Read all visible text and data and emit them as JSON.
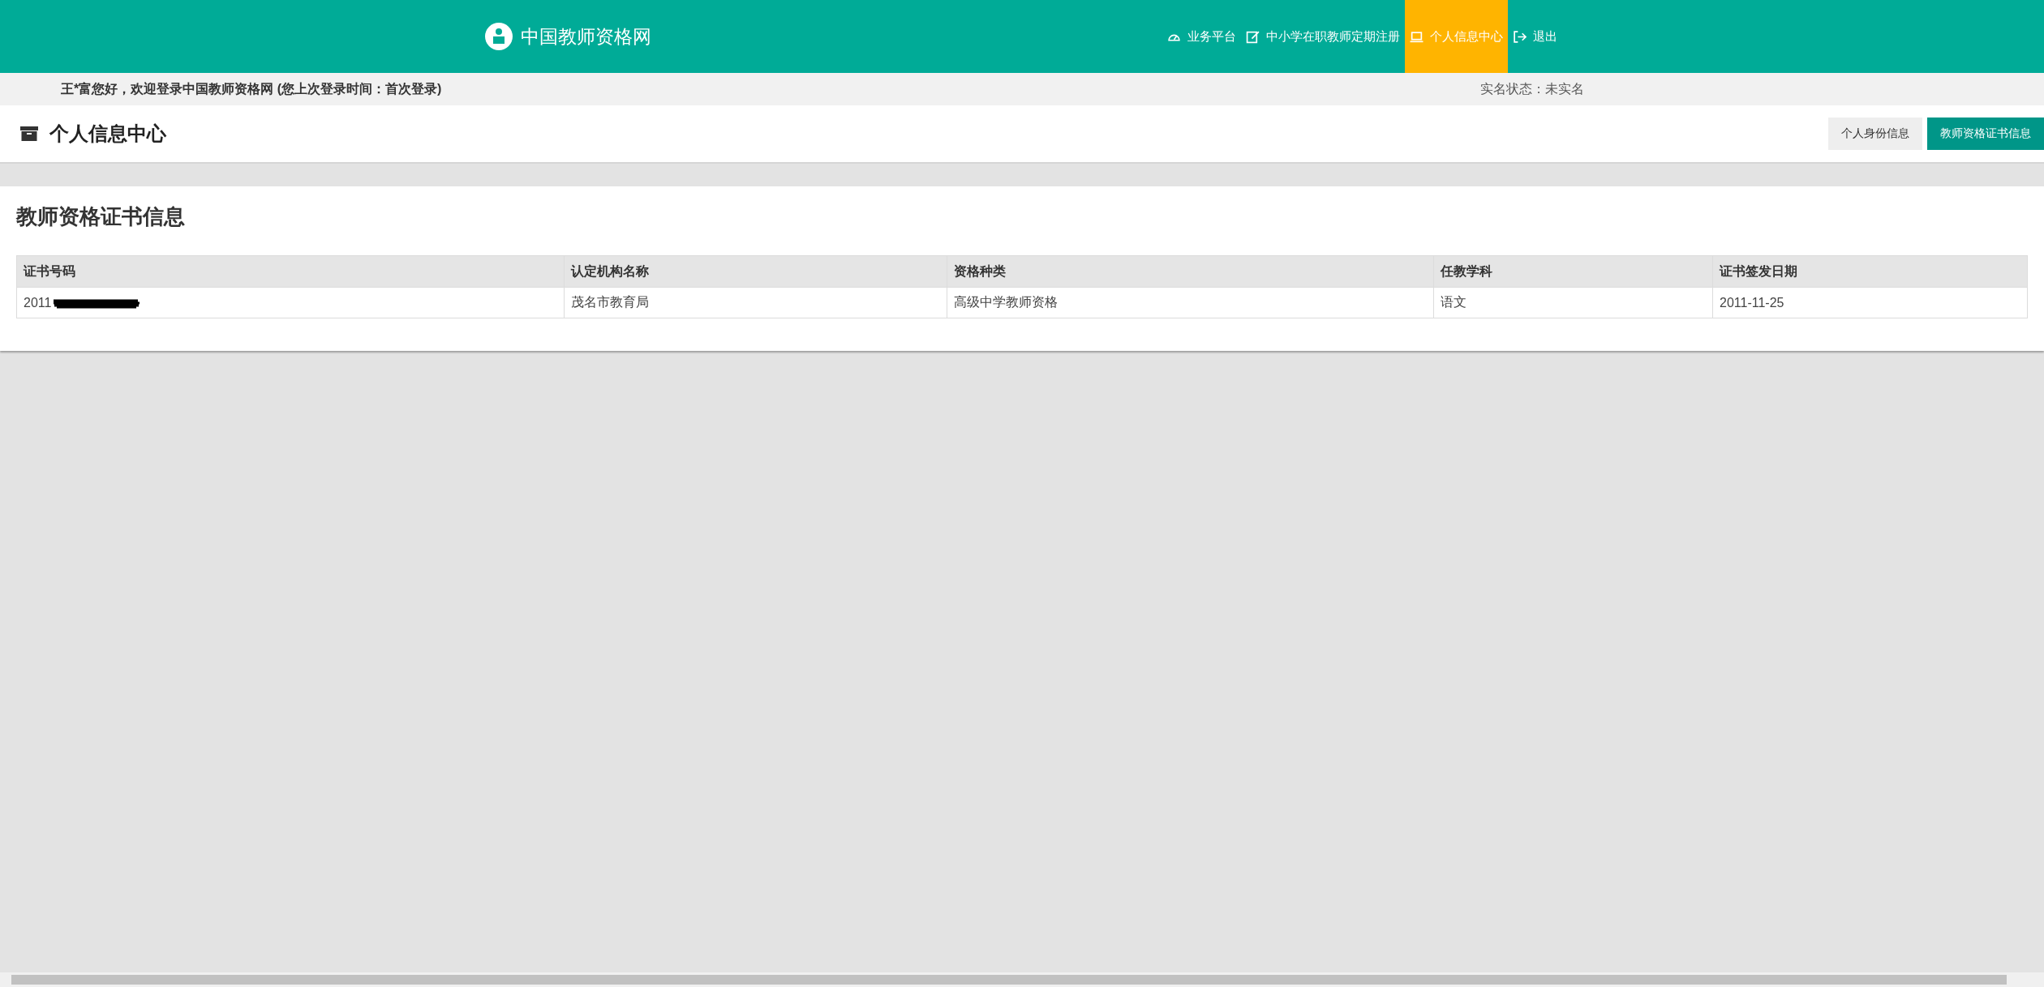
{
  "header": {
    "site_title": "中国教师资格网",
    "nav": [
      {
        "label": "业务平台",
        "selected": false
      },
      {
        "label": "中小学在职教师定期注册",
        "selected": false
      },
      {
        "label": "个人信息中心",
        "selected": true
      },
      {
        "label": "退出",
        "selected": false
      }
    ]
  },
  "info_bar": {
    "greeting": "王*富您好，欢迎登录中国教师资格网 (您上次登录时间：首次登录)",
    "status": "实名状态：未实名"
  },
  "page_title": "个人信息中心",
  "tabs": [
    {
      "label": "个人身份信息",
      "selected": false
    },
    {
      "label": "教师资格证书信息",
      "selected": true
    }
  ],
  "card": {
    "title": "教师资格证书信息",
    "table": {
      "columns": [
        "证书号码",
        "认定机构名称",
        "资格种类",
        "任教学科",
        "证书签发日期"
      ],
      "rows": [
        {
          "cells": [
            "2011",
            "茂名市教育局",
            "高级中学教师资格",
            "语文",
            "2011-11-25"
          ],
          "redacted": true
        }
      ]
    }
  }
}
